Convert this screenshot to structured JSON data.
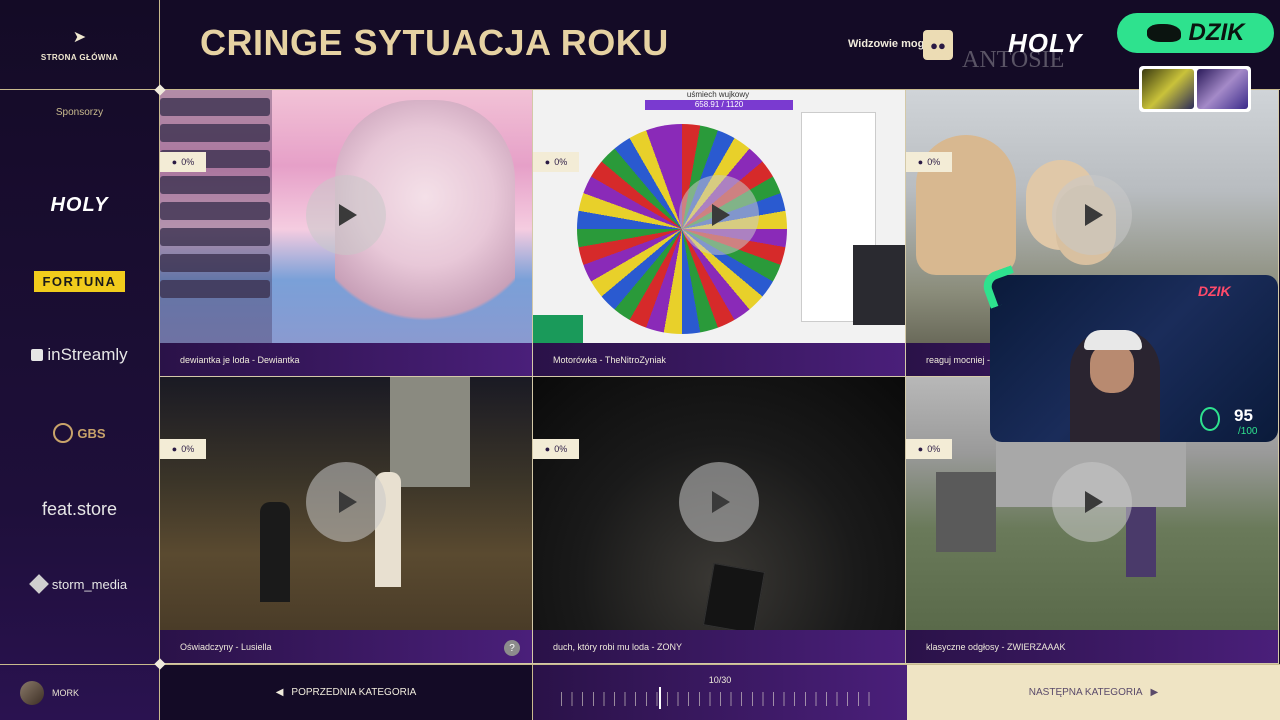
{
  "sidebar": {
    "home_label": "STRONA GŁÓWNA",
    "sponsors_title": "Sponsorzy",
    "sponsors": {
      "holy": "HOLY",
      "fortuna": "FORTUNA",
      "instreamly": "inStreamly",
      "gbs": "GBS",
      "featstore": "feat.store",
      "storm": "storm_media"
    },
    "user_name": "MORK"
  },
  "header": {
    "title": "CRINGE SYTUACJA ROKU",
    "viewers_label": "Widzowie mogą",
    "holy_logo": "HOLY",
    "dzik_label": "DZIK"
  },
  "tiles": [
    {
      "caption": "dewiantka je loda - Dewiantka",
      "percent": "0%"
    },
    {
      "caption": "Motorówka - TheNitroZyniak",
      "percent": "0%"
    },
    {
      "caption": "reaguj mocniej - I",
      "percent": "0%"
    },
    {
      "caption": "Oświadczyny - Lusiella",
      "percent": "0%"
    },
    {
      "caption": "duch, który robi mu loda - ZONY",
      "percent": "0%"
    },
    {
      "caption": "klasyczne odgłosy - ZWIERZAAAK",
      "percent": "0%"
    }
  ],
  "wheel": {
    "title": "uśmiech wujkowy",
    "progress": "658.91 / 1120"
  },
  "help_label": "?",
  "cam": {
    "neon": "DZIK",
    "score": "95",
    "score_max": "/100"
  },
  "footer": {
    "prev_label": "POPRZEDNIA KATEGORIA",
    "counter": "10/30",
    "next_label": "NASTĘPNA KATEGORIA"
  },
  "colors": {
    "accent_gold": "#e6d2a2",
    "dzik_green": "#2ee28e",
    "border": "#c9bb8e",
    "caption_purple": "#4a1f7a"
  }
}
